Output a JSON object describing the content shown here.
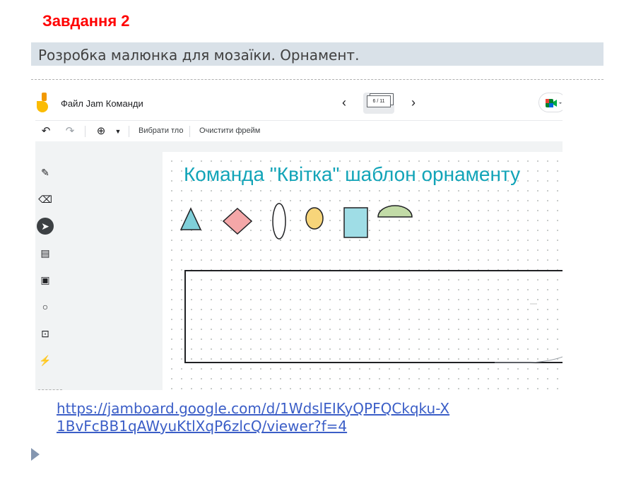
{
  "slide": {
    "task_title": "Завдання 2",
    "subtitle": "Розробка малюнка для мозаїки. Орнамент.",
    "link_text": "https://jamboard.google.com/d/1WdslEIKyQPFQCkqku-X1BvFcBB1qAWyuKtlXqP6zlcQ/viewer?f=4"
  },
  "jamboard": {
    "file_title": "Файл Jam Команди",
    "frame_counter": "6 / 11",
    "toolbar": {
      "set_background": "Вибрати тло",
      "clear_frame": "Очистити фрейм"
    },
    "canvas_title": "Команда \"Квітка\" шаблон орнаменту",
    "colors": {
      "title": "#12a4b8",
      "triangle": "#7fcfd9",
      "diamond": "#f4a7a8",
      "circle": "#f7d57a",
      "square": "#9fdde6",
      "semicircle": "#c2dba7"
    },
    "side_tools": [
      "pen-icon",
      "eraser-icon",
      "select-icon",
      "sticky-note-icon",
      "image-icon",
      "circle-icon",
      "text-box-icon",
      "laser-icon"
    ]
  }
}
